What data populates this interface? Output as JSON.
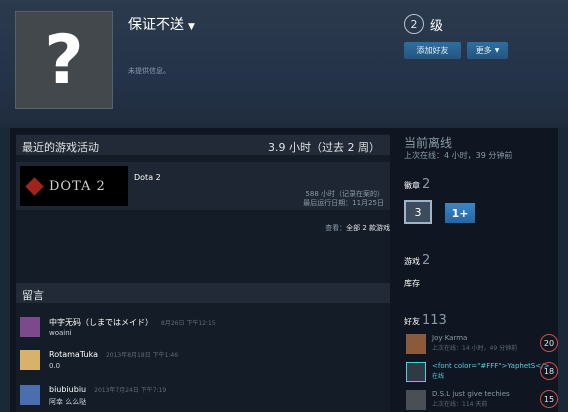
{
  "profile": {
    "name": "保证不送",
    "summary": "未提供信息。",
    "avatar_icon": "question-mark-icon",
    "level": "2",
    "level_suffix": "级",
    "add_friend_label": "添加好友",
    "more_label": "更多"
  },
  "activity": {
    "title": "最近的游戏活动",
    "hours_summary": "3.9 小时（过去 2 周）",
    "game": {
      "logo_text": "DOTA 2",
      "name": "Dota 2",
      "hours_on_record": "588 小时（记录在案的）",
      "last_played": "最后运行日期：11月25日"
    },
    "view_all_prefix": "查看：",
    "view_all_link": "全部 2 款游戏"
  },
  "comments": {
    "title": "留言",
    "items": [
      {
        "author": "中字无码（しまではメイド）",
        "date": "8月26日 下午12:15",
        "text": "woaini",
        "avatar_color": "#7b4a8a"
      },
      {
        "author": "RotamaTuka",
        "date": "2013年8月18日 下午1:46",
        "text": "0.0",
        "avatar_color": "#d8b26a"
      },
      {
        "author": "biubiubiu",
        "date": "2013年7月24日 下午7:19",
        "text": "阿幸 么么哒",
        "avatar_color": "#4b6fae"
      }
    ]
  },
  "sidebar": {
    "status": "当前离线",
    "last_online": "上次在线：4 小时，39 分钟前",
    "badges_label": "徽章",
    "badges_count": "2",
    "badge_level": "3",
    "badge_plus": "1+",
    "games_label": "游戏",
    "games_count": "2",
    "inventory_label": "库存",
    "friends_label": "好友",
    "friends_count": "113",
    "friends": [
      {
        "name": "Joy Karma",
        "sub": "上次在线：14 小时，49 分钟前",
        "level": "20",
        "online": false,
        "avatar_color": "#8a5a3a"
      },
      {
        "name": "<font color=\"#FFF\">YaphetS</>",
        "sub": "在线",
        "level": "18",
        "online": true,
        "avatar_color": "#2f3a44"
      },
      {
        "name": "D.S.L just give techies",
        "sub": "上次在线：114 天前",
        "level": "15",
        "online": false,
        "avatar_color": "#4a4f57"
      }
    ]
  }
}
